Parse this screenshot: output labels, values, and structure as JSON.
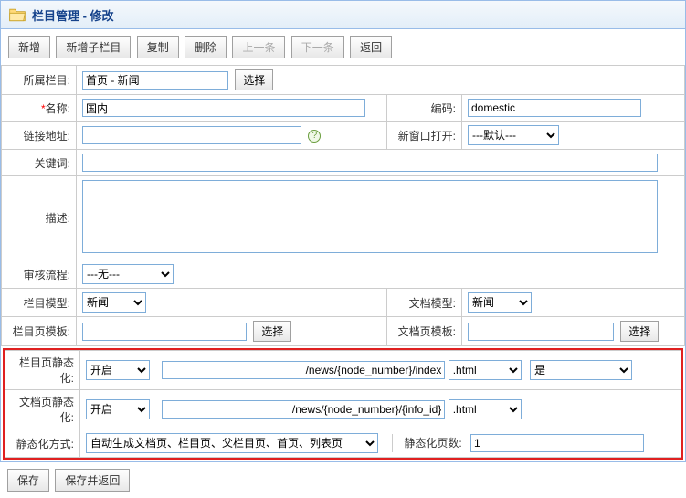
{
  "header": {
    "title": "栏目管理 - 修改"
  },
  "toolbar": {
    "new": "新增",
    "new_child": "新增子栏目",
    "copy": "复制",
    "delete": "删除",
    "prev": "上一条",
    "next": "下一条",
    "back": "返回"
  },
  "labels": {
    "parent": "所属栏目:",
    "name": "名称:",
    "code": "编码:",
    "link": "链接地址:",
    "new_window": "新窗口打开:",
    "keywords": "关键词:",
    "description": "描述:",
    "workflow": "审核流程:",
    "col_model": "栏目模型:",
    "doc_model": "文档模型:",
    "col_tpl": "栏目页模板:",
    "doc_tpl": "文档页模板:",
    "col_static": "栏目页静态化:",
    "doc_static": "文档页静态化:",
    "static_mode": "静态化方式:",
    "static_count": "静态化页数:"
  },
  "buttons": {
    "select": "选择",
    "save": "保存",
    "save_back": "保存并返回"
  },
  "values": {
    "parent": "首页 - 新闻",
    "name": "国内",
    "code": "domestic",
    "link": "",
    "new_window": "---默认---",
    "keywords": "",
    "description": "",
    "workflow": "---无---",
    "col_model": "新闻",
    "doc_model": "新闻",
    "col_tpl": "",
    "doc_tpl": "",
    "col_static_enable": "开启",
    "col_static_path": "/news/{node_number}/index",
    "col_static_ext": ".html",
    "col_static_yes": "是",
    "doc_static_enable": "开启",
    "doc_static_path": "/news/{node_number}/{info_id}",
    "doc_static_ext": ".html",
    "static_mode": "自动生成文档页、栏目页、父栏目页、首页、列表页",
    "static_count": "1"
  }
}
